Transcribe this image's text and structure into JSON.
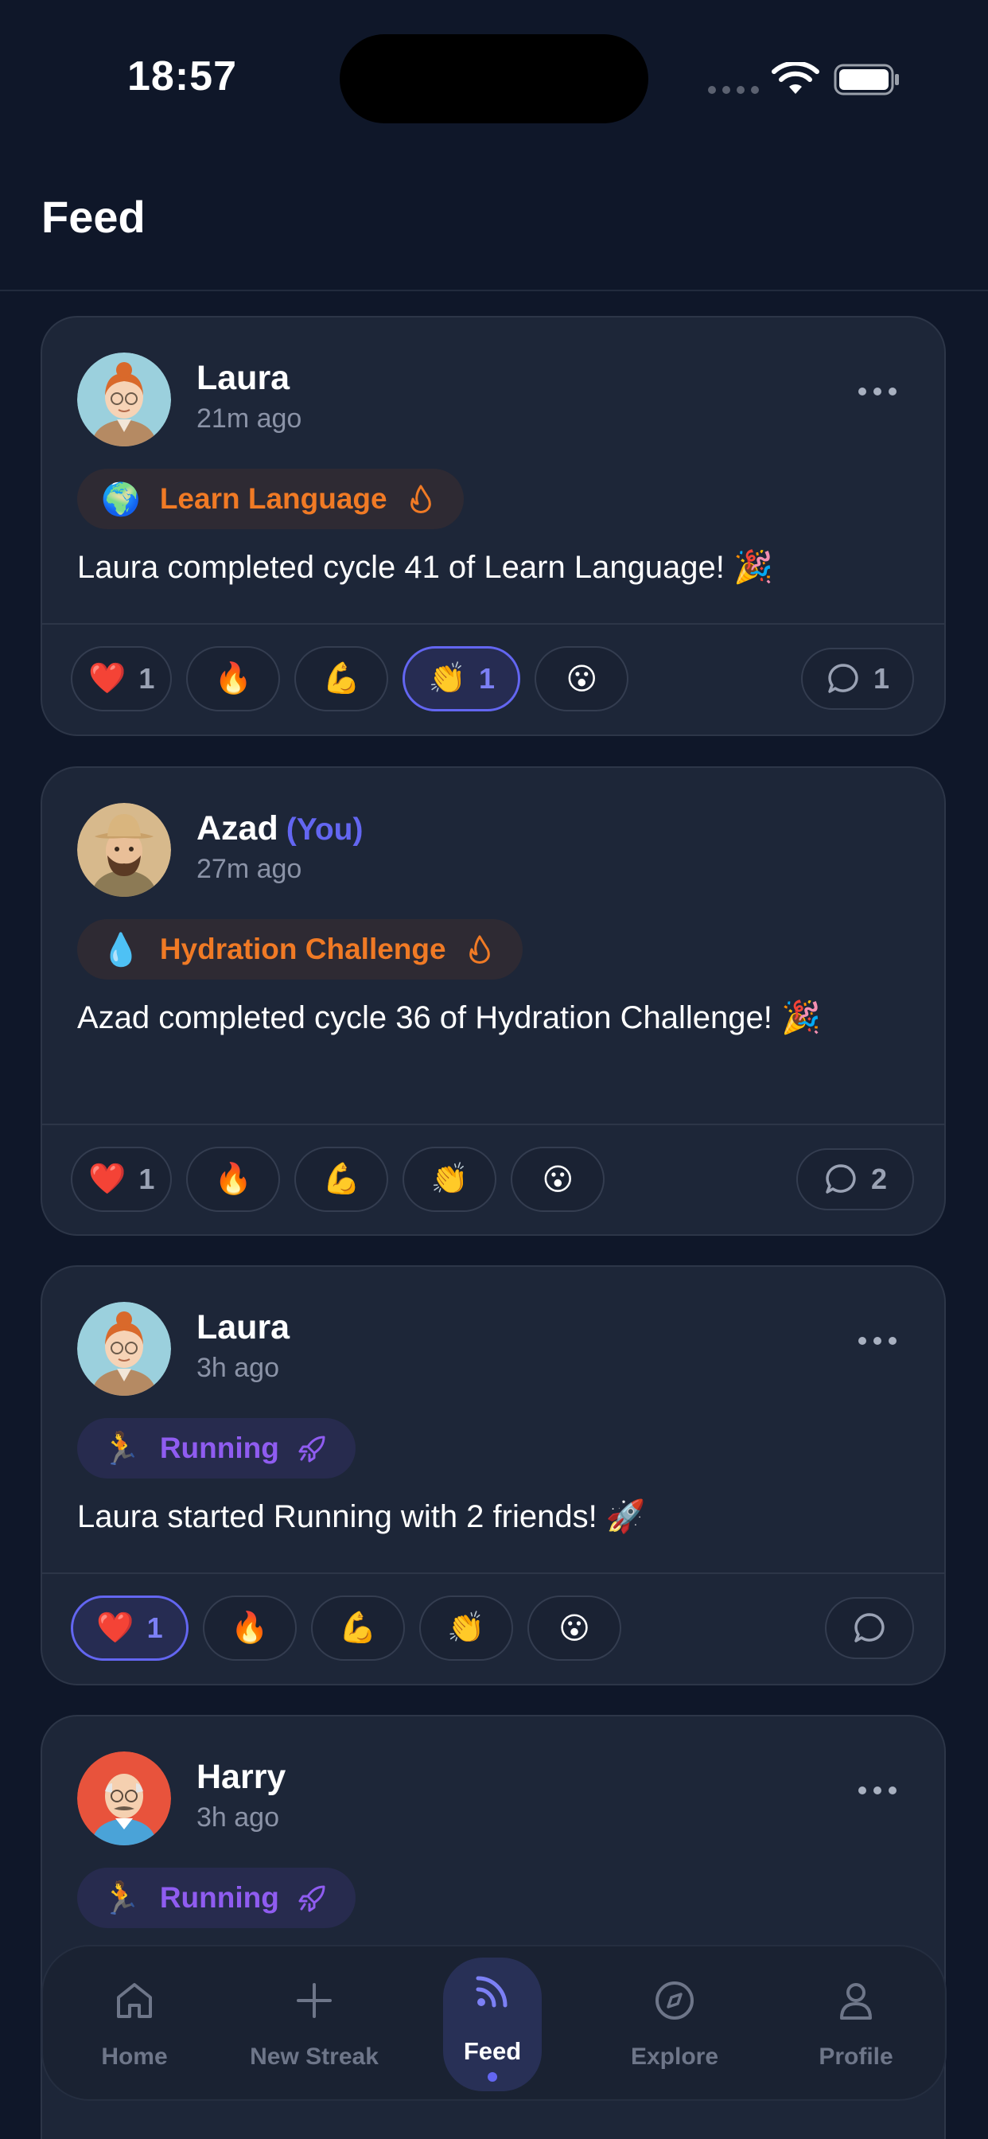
{
  "status_bar": {
    "time": "18:57"
  },
  "header": {
    "title": "Feed"
  },
  "posts": [
    {
      "user": "Laura",
      "you_label": "",
      "time_ago": "21m ago",
      "tag": {
        "emoji": "🌍",
        "label": "Learn Language",
        "style": "orange",
        "icon": "flame-icon"
      },
      "text": "Laura completed cycle 41 of Learn Language! 🎉",
      "reactions": [
        {
          "emoji": "❤️",
          "count": "1",
          "active": false
        },
        {
          "emoji": "🔥",
          "count": "",
          "active": false
        },
        {
          "emoji": "💪",
          "count": "",
          "active": false
        },
        {
          "emoji": "👏",
          "count": "1",
          "active": true
        },
        {
          "emoji": "😮",
          "count": "",
          "active": false
        }
      ],
      "comments": "1",
      "has_menu": true
    },
    {
      "user": "Azad",
      "you_label": "(You)",
      "time_ago": "27m ago",
      "tag": {
        "emoji": "💧",
        "label": "Hydration Challenge",
        "style": "orange",
        "icon": "flame-icon"
      },
      "text": "Azad completed cycle 36 of Hydration Challenge! 🎉",
      "reactions": [
        {
          "emoji": "❤️",
          "count": "1",
          "active": false
        },
        {
          "emoji": "🔥",
          "count": "",
          "active": false
        },
        {
          "emoji": "💪",
          "count": "",
          "active": false
        },
        {
          "emoji": "👏",
          "count": "",
          "active": false
        },
        {
          "emoji": "😮",
          "count": "",
          "active": false
        }
      ],
      "comments": "2",
      "has_menu": false
    },
    {
      "user": "Laura",
      "you_label": "",
      "time_ago": "3h ago",
      "tag": {
        "emoji": "🏃",
        "label": "Running",
        "style": "purple",
        "icon": "rocket-icon"
      },
      "text": "Laura started Running with 2 friends! 🚀",
      "reactions": [
        {
          "emoji": "❤️",
          "count": "1",
          "active": true
        },
        {
          "emoji": "🔥",
          "count": "",
          "active": false
        },
        {
          "emoji": "💪",
          "count": "",
          "active": false
        },
        {
          "emoji": "👏",
          "count": "",
          "active": false
        },
        {
          "emoji": "😮",
          "count": "",
          "active": false
        }
      ],
      "comments": "",
      "has_menu": true
    },
    {
      "user": "Harry",
      "you_label": "",
      "time_ago": "3h ago",
      "tag": {
        "emoji": "🏃",
        "label": "Running",
        "style": "purple",
        "icon": "rocket-icon"
      },
      "text": "",
      "reactions": [],
      "comments": "",
      "has_menu": true
    }
  ],
  "bottom_nav": {
    "items": [
      {
        "label": "Home",
        "icon": "home-icon",
        "active": false
      },
      {
        "label": "New Streak",
        "icon": "plus-icon",
        "active": false
      },
      {
        "label": "Feed",
        "icon": "feed-icon",
        "active": true
      },
      {
        "label": "Explore",
        "icon": "compass-icon",
        "active": false
      },
      {
        "label": "Profile",
        "icon": "person-icon",
        "active": false
      }
    ]
  },
  "colors": {
    "background": "#0f1729",
    "card": "#1d2638",
    "accent": "#6366f1",
    "orange": "#f07a25",
    "purple": "#8f5cf0"
  }
}
